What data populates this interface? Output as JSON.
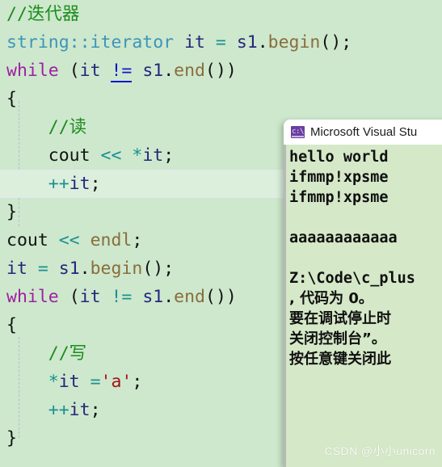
{
  "editor": {
    "background_color": "#cde8cd",
    "current_line_color": "#dcefdc",
    "lines": [
      {
        "id": "l1",
        "text": "//迭代器",
        "current": false
      },
      {
        "id": "l2",
        "text": "string::iterator it = s1.begin();",
        "current": false
      },
      {
        "id": "l3",
        "text": "while (it != s1.end())",
        "current": false
      },
      {
        "id": "l4",
        "text": "{",
        "current": false
      },
      {
        "id": "l5",
        "text": "    //读",
        "current": false
      },
      {
        "id": "l6",
        "text": "    cout << *it;",
        "current": false
      },
      {
        "id": "l7",
        "text": "    ++it;",
        "current": true
      },
      {
        "id": "l8",
        "text": "}",
        "current": false
      },
      {
        "id": "l9",
        "text": "cout << endl;",
        "current": false
      },
      {
        "id": "l10",
        "text": "it = s1.begin();",
        "current": false
      },
      {
        "id": "l11",
        "text": "while (it != s1.end())",
        "current": false
      },
      {
        "id": "l12",
        "text": "{",
        "current": false
      },
      {
        "id": "l13",
        "text": "    //写",
        "current": false
      },
      {
        "id": "l14",
        "text": "    *it ='a';",
        "current": false
      },
      {
        "id": "l15",
        "text": "    ++it;",
        "current": false
      },
      {
        "id": "l16",
        "text": "}",
        "current": false
      }
    ],
    "tokens": {
      "comment_iterator": "//迭代器",
      "comment_read": "//读",
      "comment_write": "//写",
      "type_string_iterator": "string::iterator",
      "keyword_while": "while",
      "identifier_it": "it",
      "identifier_s1": "s1",
      "identifier_cout": "cout",
      "identifier_endl": "endl",
      "method_begin": "begin",
      "method_end": "end",
      "operator_not_equal": "!=",
      "operator_shift_left": "<<",
      "operator_increment": "++",
      "operator_deref": "*",
      "operator_assign": "=",
      "char_literal_a": "'a'",
      "brace_open": "{",
      "brace_close": "}",
      "semicolon": ";",
      "paren_open": "(",
      "paren_close": ")",
      "dot": "."
    },
    "colors": {
      "comment": "#1d8b1d",
      "type": "#3f94b8",
      "keyword": "#a020a0",
      "operator": "#1a9090",
      "identifier": "#26267a",
      "member": "#8a6d3b",
      "string": "#a31515",
      "reference_highlight": "#1414d0",
      "plain": "#121212"
    }
  },
  "console": {
    "title": "Microsoft Visual Stu",
    "icon": "console-window-icon",
    "icon_glyph": "c:\\",
    "background_color": "#d5e8c8",
    "titlebar_color": "#ffffff",
    "lines": [
      {
        "id": "c1",
        "text": "hello world",
        "cjk": false
      },
      {
        "id": "c2",
        "text": "ifmmp!xpsme",
        "cjk": false
      },
      {
        "id": "c3",
        "text": "ifmmp!xpsme",
        "cjk": false
      },
      {
        "id": "c4",
        "text": "",
        "cjk": false
      },
      {
        "id": "c5",
        "text": "aaaaaaaaaaaa",
        "cjk": false
      },
      {
        "id": "c6",
        "text": "",
        "cjk": false
      },
      {
        "id": "c7",
        "text": "Z:\\Code\\c_plus",
        "cjk": false
      },
      {
        "id": "c8",
        "text": ", 代码为 0。",
        "cjk": true
      },
      {
        "id": "c9",
        "text": "要在调试停止时",
        "cjk": true
      },
      {
        "id": "c10",
        "text": "关闭控制台”。",
        "cjk": true
      },
      {
        "id": "c11",
        "text": "按任意键关闭此",
        "cjk": true
      }
    ]
  },
  "watermark": {
    "text": "CSDN @小小unicorn"
  }
}
